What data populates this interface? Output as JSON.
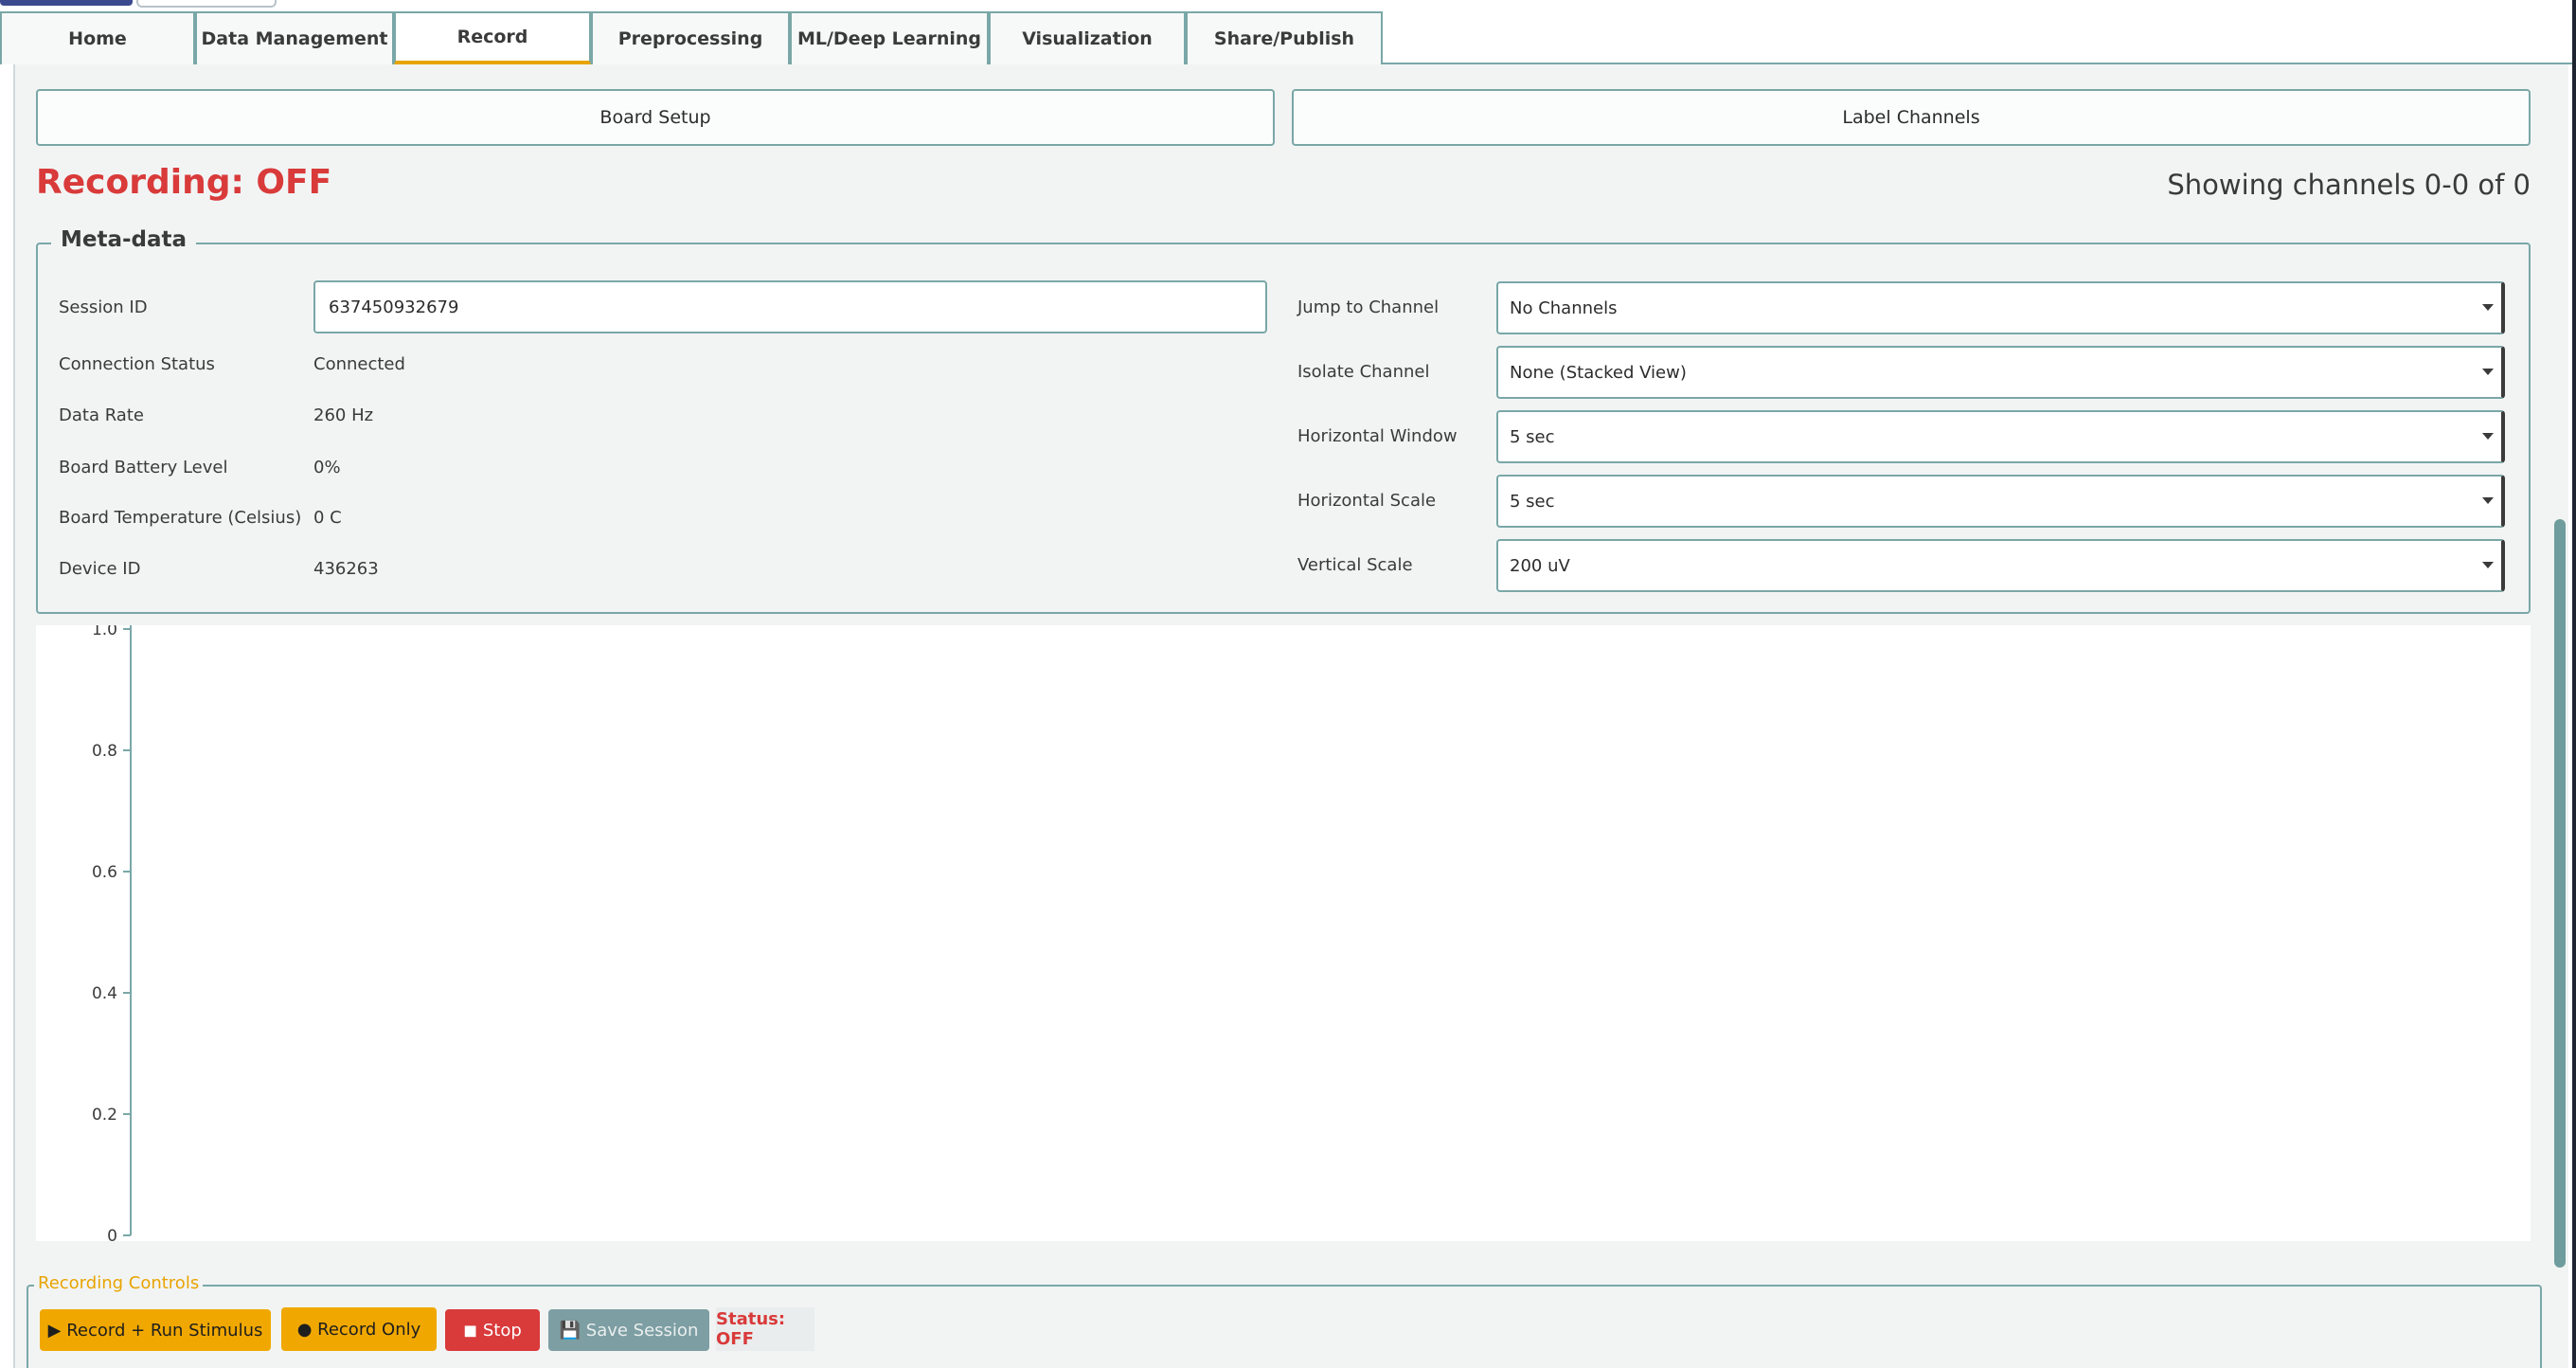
{
  "tabs": [
    {
      "label": "Home",
      "active": false
    },
    {
      "label": "Data Management",
      "active": false
    },
    {
      "label": "Record",
      "active": true
    },
    {
      "label": "Preprocessing",
      "active": false
    },
    {
      "label": "ML/Deep Learning",
      "active": false
    },
    {
      "label": "Visualization",
      "active": false
    },
    {
      "label": "Share/Publish",
      "active": false
    }
  ],
  "actions": {
    "board_setup": "Board Setup",
    "label_channels": "Label Channels"
  },
  "recording_status": "Recording: OFF",
  "channel_info": "Showing channels 0-0 of 0",
  "meta": {
    "legend": "Meta-data",
    "session_id_label": "Session ID",
    "session_id_value": "637450932679",
    "connection_status_label": "Connection Status",
    "connection_status_value": "Connected",
    "data_rate_label": "Data Rate",
    "data_rate_value": "260 Hz",
    "battery_label": "Board Battery Level",
    "battery_value": "0%",
    "temperature_label": "Board Temperature (Celsius)",
    "temperature_value": "0 C",
    "device_id_label": "Device ID",
    "device_id_value": "436263",
    "jump_label": "Jump to Channel",
    "jump_value": "No Channels",
    "isolate_label": "Isolate Channel",
    "isolate_value": "None (Stacked View)",
    "hwindow_label": "Horizontal Window",
    "hwindow_value": "5 sec",
    "hscale_label": "Horizontal Scale",
    "hscale_value": "5 sec",
    "vscale_label": "Vertical Scale",
    "vscale_value": "200 uV"
  },
  "plot": {
    "yticks": [
      "1.0",
      "0.8",
      "0.6",
      "0.4",
      "0.2",
      "0"
    ],
    "ylim": [
      0,
      1.0
    ]
  },
  "controls": {
    "legend": "Recording Controls",
    "record_stimulus": "▶ Record + Run Stimulus",
    "record_only": "● Record Only",
    "stop": "◼ Stop",
    "save_session": "💾 Save Session",
    "status": "Status: OFF"
  },
  "colors": {
    "accent": "#e8a400",
    "status_off": "#d93a3a",
    "border": "#7aa7a7"
  }
}
